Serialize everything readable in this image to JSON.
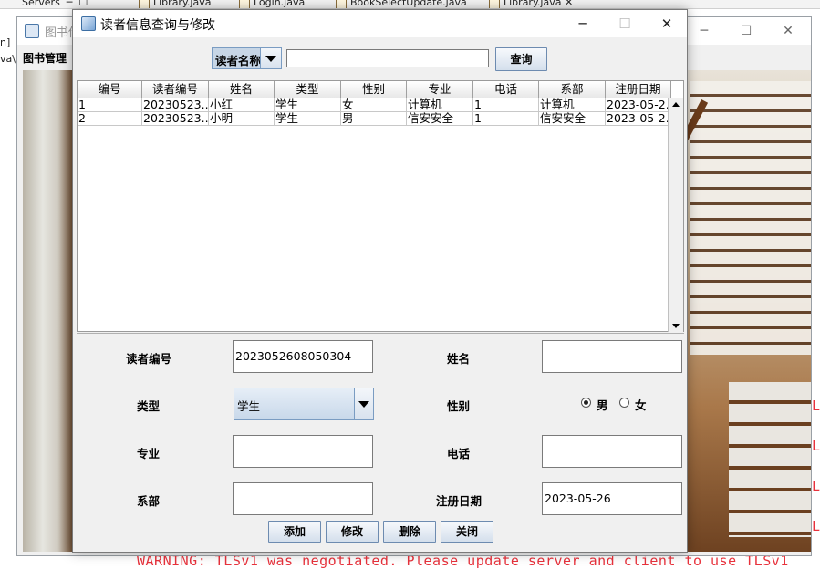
{
  "ide": {
    "tabs": [
      "Servers",
      "Library.java",
      "Login.java",
      "BookSelectUpdate.java",
      "Library.java"
    ],
    "left_fragments": [
      "n]",
      "va\\j"
    ],
    "console_warning": "WARNING: TLSv1 was negotiated. Please update server and client to use TLSv1",
    "right_fragments": [
      "L",
      "L",
      "L",
      "L"
    ]
  },
  "main_frame": {
    "title": "图书借",
    "menu": "图书管理"
  },
  "dialog": {
    "title": "读者信息查询与修改",
    "controls": [
      "─",
      "☐",
      "✕"
    ],
    "search": {
      "field_selected": "读者名称",
      "value": "",
      "button": "查询"
    },
    "table": {
      "columns": [
        "编号",
        "读者编号",
        "姓名",
        "类型",
        "性别",
        "专业",
        "电话",
        "系部",
        "注册日期"
      ],
      "rows": [
        [
          "1",
          "20230523...",
          "小红",
          "学生",
          "女",
          "计算机",
          "1",
          "计算机",
          "2023-05-2..."
        ],
        [
          "2",
          "20230523...",
          "小明",
          "学生",
          "男",
          "信安安全",
          "1",
          "信安安全",
          "2023-05-2..."
        ]
      ]
    },
    "form": {
      "reader_id_label": "读者编号",
      "reader_id_value": "2023052608050304",
      "name_label": "姓名",
      "name_value": "",
      "type_label": "类型",
      "type_value": "学生",
      "gender_label": "性别",
      "gender_male": "男",
      "gender_female": "女",
      "gender_selected": "男",
      "major_label": "专业",
      "major_value": "",
      "phone_label": "电话",
      "phone_value": "",
      "dept_label": "系部",
      "dept_value": "",
      "date_label": "注册日期",
      "date_value": "2023-05-26"
    },
    "buttons": {
      "add": "添加",
      "modify": "修改",
      "delete": "删除",
      "close": "关闭"
    }
  }
}
